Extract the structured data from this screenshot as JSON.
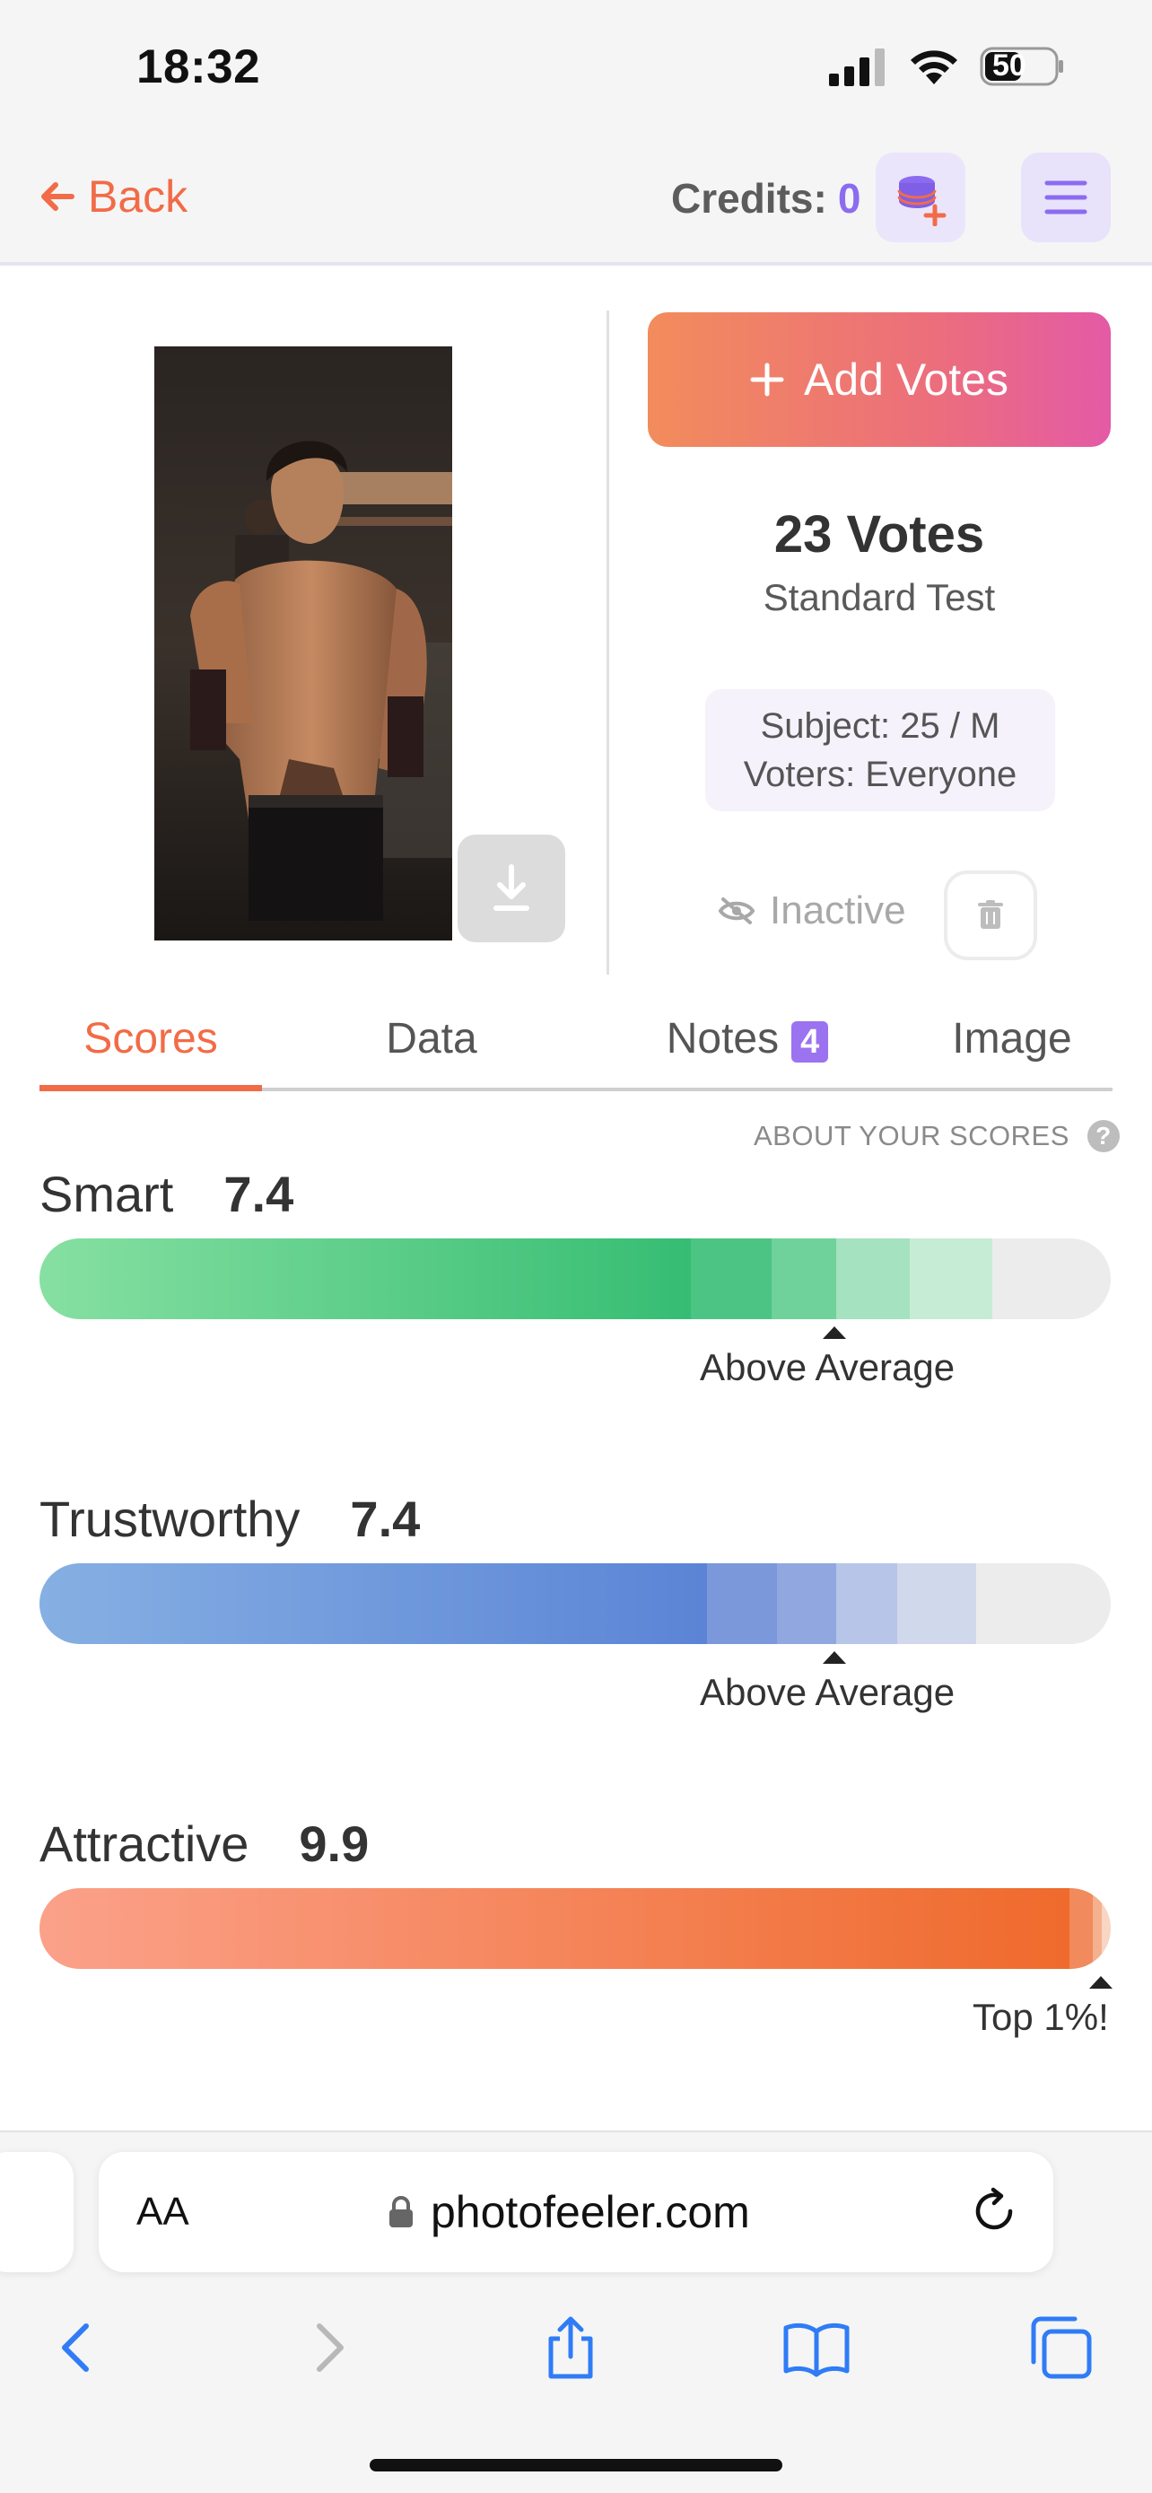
{
  "status_bar": {
    "time": "18:32",
    "battery": "50"
  },
  "header": {
    "back_label": "Back",
    "credits_label": "Credits:",
    "credits_value": "0"
  },
  "test": {
    "add_votes_label": "Add Votes",
    "votes_count": "23 Votes",
    "test_type": "Standard Test",
    "subject": "Subject: 25 / M",
    "voters": "Voters: Everyone",
    "status": "Inactive"
  },
  "tabs": [
    {
      "label": "Scores"
    },
    {
      "label": "Data"
    },
    {
      "label": "Notes",
      "badge": "4"
    },
    {
      "label": "Image"
    }
  ],
  "about_scores_label": "ABOUT YOUR SCORES",
  "scores": [
    {
      "name": "Smart",
      "value": "7.4",
      "rating": "Above Average",
      "fill_fraction": 0.74,
      "color": "#3cbf77"
    },
    {
      "name": "Trustworthy",
      "value": "7.4",
      "rating": "Above Average",
      "fill_fraction": 0.74,
      "color": "#5b86d6"
    },
    {
      "name": "Attractive",
      "value": "9.9",
      "rating": "Top 1%!",
      "fill_fraction": 0.99,
      "color": "#f06a2c"
    }
  ],
  "browser": {
    "aa_label": "AA",
    "url": "photofeeler.com"
  },
  "colors": {
    "accent": "#f26b47",
    "purple": "#9b72f0"
  }
}
